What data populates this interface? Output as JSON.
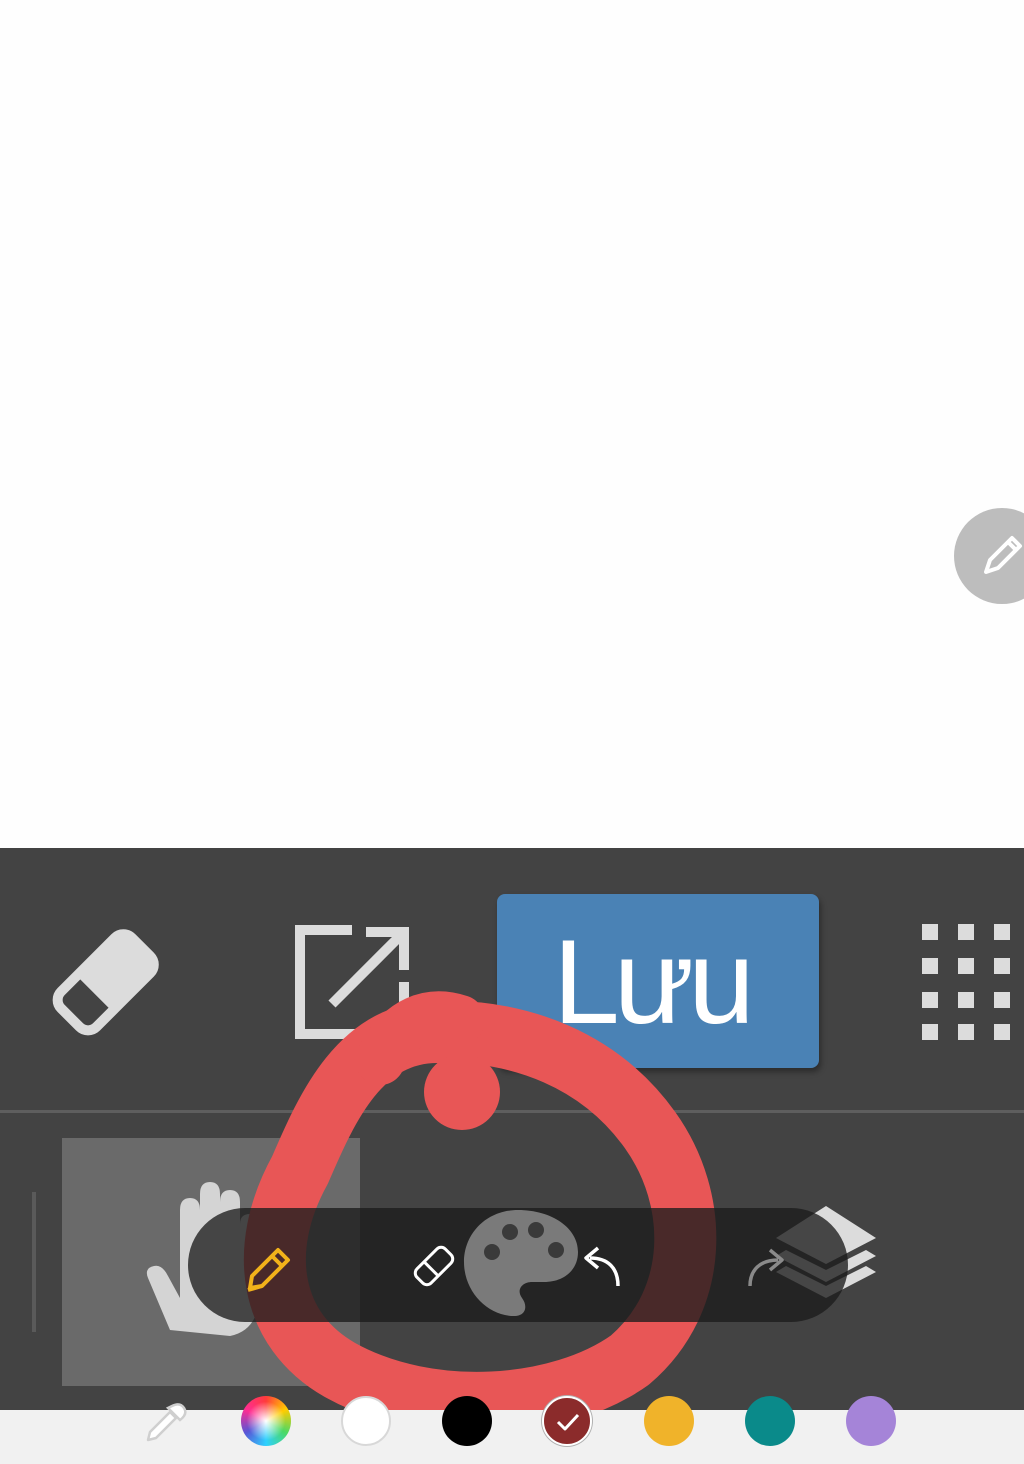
{
  "toolbar": {
    "save_label": "Lưu"
  },
  "icons": {
    "edit_fab": "pencil-icon",
    "eraser_large": "eraser-icon",
    "export": "open-external-icon",
    "grid": "grid-dots-icon",
    "hand": "hand-icon",
    "pen": "pen-icon",
    "eraser_small": "eraser-icon",
    "palette": "palette-icon",
    "undo": "undo-icon",
    "redo": "redo-icon",
    "layers": "layers-icon",
    "eyedropper": "eyedropper-icon"
  },
  "colors": {
    "accent_save": "#4a82b5",
    "panel_bg": "#434343",
    "active_tool": "#f2b21a",
    "annotation_mark": "#e85656",
    "swatches": [
      "rainbow",
      "#ffffff",
      "#000000",
      "#8b2b2b",
      "#f0b32a",
      "#0a8a8a",
      "#a584d8"
    ],
    "selected_swatch": "#8b2b2b"
  }
}
